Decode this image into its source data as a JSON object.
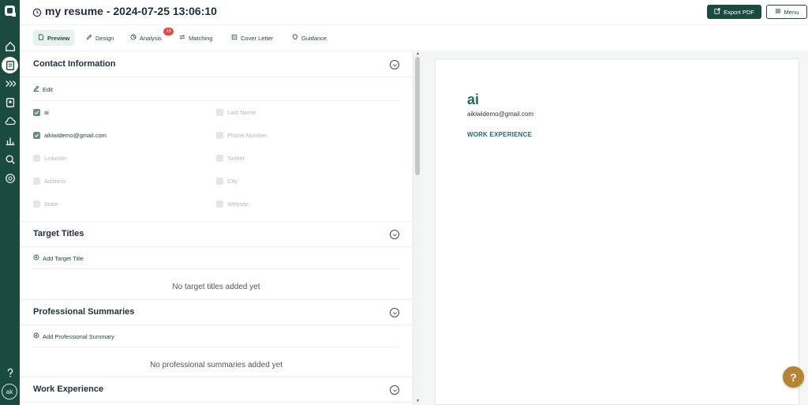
{
  "header": {
    "title": "my resume - 2024-07-25 13:06:10",
    "export_label": "Export PDF",
    "menu_label": "Menu"
  },
  "tabs": [
    {
      "label": "Preview",
      "icon": "file-icon",
      "active": true
    },
    {
      "label": "Design",
      "icon": "pencil-icon"
    },
    {
      "label": "Analysis",
      "icon": "pie-chart-icon",
      "badge": "13"
    },
    {
      "label": "Matching",
      "icon": "swap-icon"
    },
    {
      "label": "Cover Letter",
      "icon": "letter-icon"
    },
    {
      "label": "Guidance",
      "icon": "lightbulb-icon"
    }
  ],
  "contact": {
    "title": "Contact Information",
    "edit_label": "Edit",
    "fields": [
      {
        "label": "ai",
        "checked": true
      },
      {
        "label": "Last Name",
        "checked": false
      },
      {
        "label": "aikiwidemo@gmail.com",
        "checked": true
      },
      {
        "label": "Phone Number",
        "checked": false
      },
      {
        "label": "LinkedIn",
        "checked": false
      },
      {
        "label": "Twitter",
        "checked": false
      },
      {
        "label": "Address",
        "checked": false
      },
      {
        "label": "City",
        "checked": false
      },
      {
        "label": "State",
        "checked": false
      },
      {
        "label": "Website",
        "checked": false
      }
    ]
  },
  "target_titles": {
    "title": "Target Titles",
    "add_label": "Add Target Title",
    "empty_text": "No target titles added yet"
  },
  "summaries": {
    "title": "Professional Summaries",
    "add_label": "Add Professional Summary",
    "empty_text": "No professional summaries added yet"
  },
  "work": {
    "title": "Work Experience"
  },
  "preview": {
    "name": "ai",
    "email": "aikiwidemo@gmail.com",
    "section": "WORK EXPERIENCE"
  },
  "sidebar": {
    "avatar": "ak",
    "help": "?"
  },
  "colors": {
    "brand": "#1a4a40",
    "accent": "#1f6b63",
    "badge": "#e24a4a",
    "help": "#b58531"
  }
}
